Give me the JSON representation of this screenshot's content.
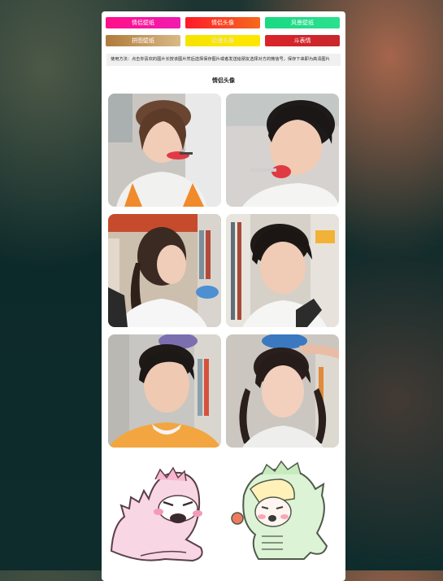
{
  "buttons": [
    {
      "label": "情侣壁纸"
    },
    {
      "label": "情侣头像"
    },
    {
      "label": "风景壁纸"
    },
    {
      "label": "拼图壁纸"
    },
    {
      "label": "动漫头像"
    },
    {
      "label": "斗表情"
    }
  ],
  "notice": "使用方法：点击你喜欢的图片长按该图片然后选择保存图片或者发送给朋友选择对方的微信号，保存下来即为高清图片",
  "section_title": "情侣头像",
  "images": [
    {
      "alt": "couple-avatar-girl-eating"
    },
    {
      "alt": "couple-avatar-boy-eating"
    },
    {
      "alt": "couple-avatar-girl-library"
    },
    {
      "alt": "couple-avatar-boy-library"
    },
    {
      "alt": "couple-avatar-boy-ball"
    },
    {
      "alt": "couple-avatar-girl-ball"
    },
    {
      "alt": "couple-avatar-pink-dino"
    },
    {
      "alt": "couple-avatar-green-dino"
    }
  ]
}
